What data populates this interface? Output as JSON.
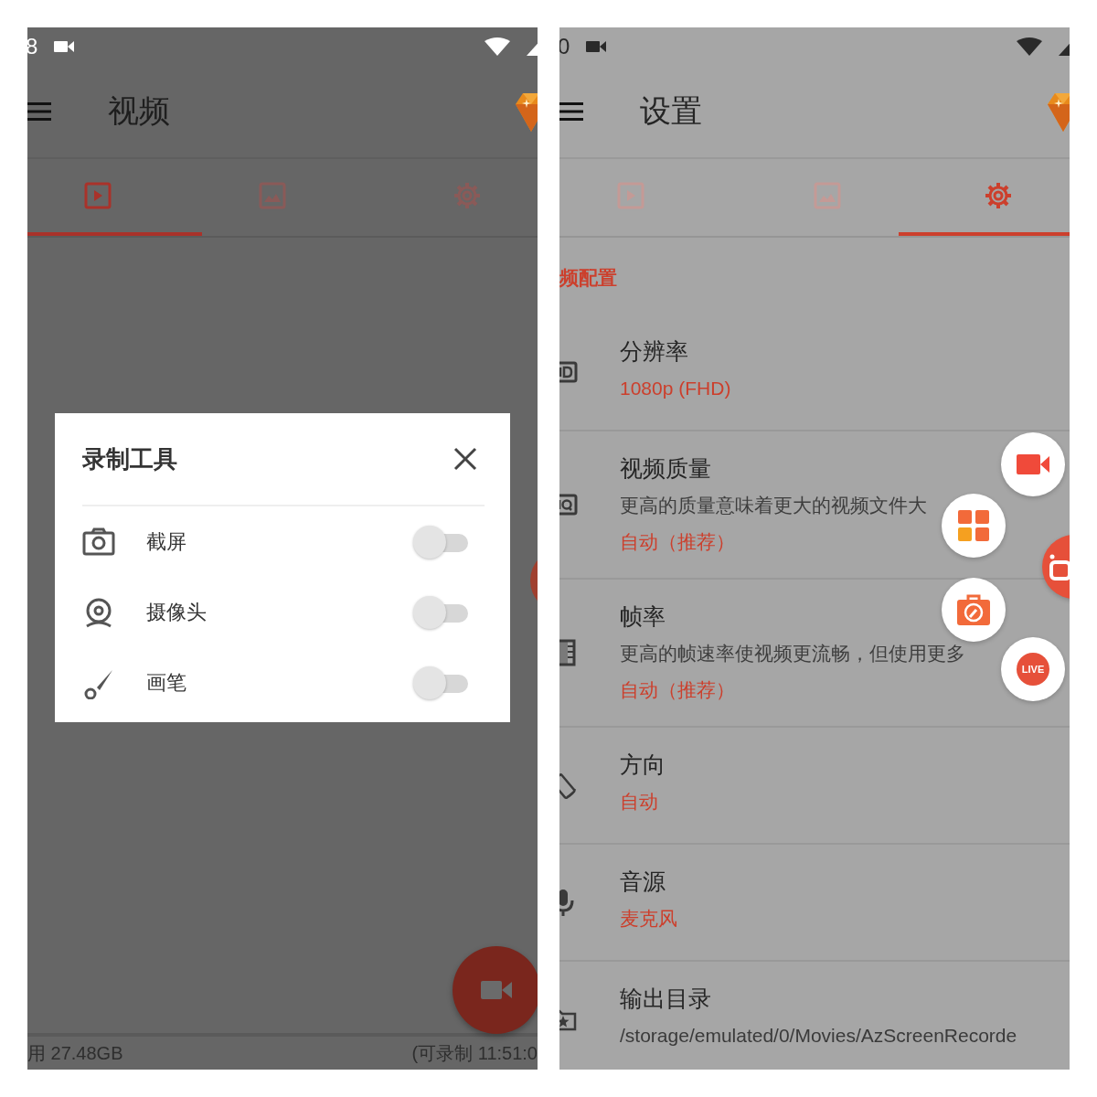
{
  "screens": [
    {
      "kind": "video",
      "status_bar": {
        "time": "8"
      },
      "app_bar": {
        "title": "视频"
      },
      "tabs": [
        {
          "kind": "play",
          "selected": true
        },
        {
          "kind": "image",
          "selected": false
        },
        {
          "kind": "gear",
          "selected": false
        }
      ],
      "dialog": {
        "title": "录制工具",
        "items": [
          {
            "kind": "camera",
            "label": "截屏",
            "on": false
          },
          {
            "kind": "webcam",
            "label": "摄像头",
            "on": false
          },
          {
            "kind": "brush",
            "label": "画笔",
            "on": false
          }
        ]
      },
      "footer": {
        "storage": "用 27.48GB",
        "remaining": "(可录制 11:51:0"
      }
    },
    {
      "kind": "settings",
      "status_bar": {
        "time": "0"
      },
      "app_bar": {
        "title": "设置"
      },
      "tabs": [
        {
          "kind": "play",
          "selected": false
        },
        {
          "kind": "image",
          "selected": false
        },
        {
          "kind": "gear",
          "selected": true
        }
      ],
      "section": "频配置",
      "settings": [
        {
          "kind": "hd",
          "title": "分辨率",
          "value": "1080p (FHD)"
        },
        {
          "kind": "hq",
          "title": "视频质量",
          "description": "更高的质量意味着更大的视频文件大",
          "value": "自动（推荐）"
        },
        {
          "kind": "film",
          "title": "帧率",
          "description": "更高的帧速率使视频更流畅，但使用更多",
          "value": "自动（推荐）"
        },
        {
          "kind": "rotate",
          "title": "方向",
          "value": "自动"
        },
        {
          "kind": "mic",
          "title": "音源",
          "value": "麦克风"
        },
        {
          "kind": "folder",
          "title": "输出目录",
          "path": "/storage/emulated/0/Movies/AzScreenRecorde"
        }
      ],
      "bubbles": [
        {
          "kind": "camera"
        },
        {
          "kind": "grid"
        },
        {
          "kind": "record"
        },
        {
          "kind": "toolbox"
        },
        {
          "kind": "live",
          "label": "LIVE"
        }
      ]
    }
  ]
}
